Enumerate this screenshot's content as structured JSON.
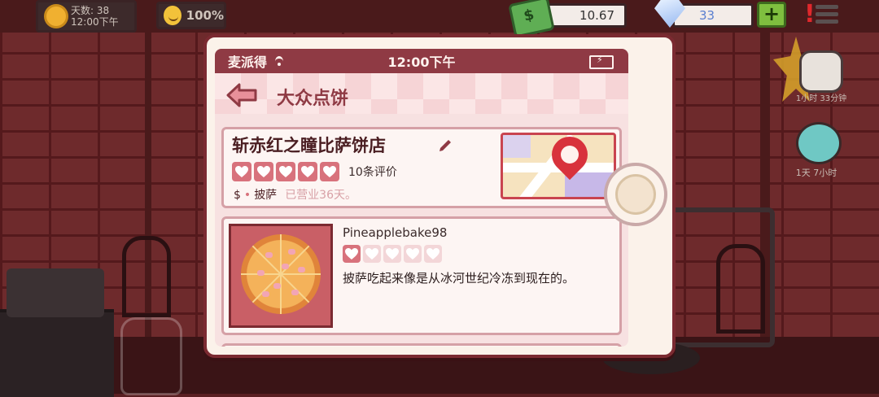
{
  "hud": {
    "day_label": "天数: 38",
    "day_time": "12:00下午",
    "mood_percent": "100%",
    "cash": "10.67",
    "gems": "33",
    "add_label": "+"
  },
  "side": {
    "jar_label": "1小时 33分钟",
    "creature_label": "1天 7小时"
  },
  "phone": {
    "carrier": "麦派得",
    "clock": "12:00下午",
    "app_title": "大众点饼",
    "shop": {
      "name": "斩赤红之瞳比萨饼店",
      "rating": 5,
      "review_count": "10条评价",
      "price": "$",
      "category": "披萨",
      "open_days": "已营业36天。"
    },
    "reviews": [
      {
        "user": "Pineapplebake98",
        "rating": 1,
        "text": "披萨吃起来像是从冰河世纪冷冻到现在的。"
      }
    ]
  },
  "colors": {
    "accent": "#8f3a44",
    "heart": "#d8727c",
    "panel": "#fbf2ea"
  }
}
